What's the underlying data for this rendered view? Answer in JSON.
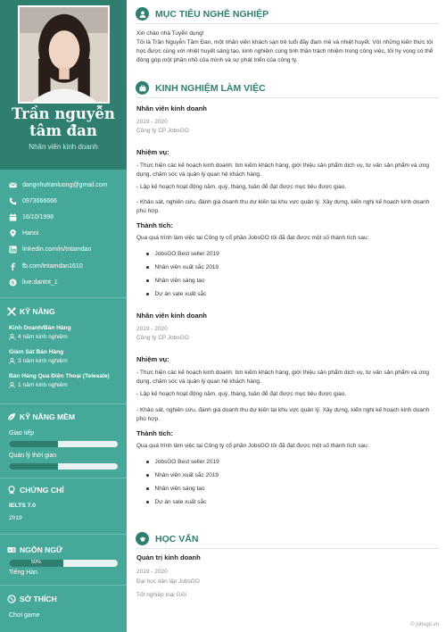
{
  "profile": {
    "name_line1": "Trần nguyễn",
    "name_line2": "tâm đan",
    "job_title": "Nhân viên kinh doanh"
  },
  "contacts": [
    {
      "icon": "email-icon",
      "text": "dangnhutranluong@gmail.com"
    },
    {
      "icon": "phone-icon",
      "text": "0973666666"
    },
    {
      "icon": "calendar-icon",
      "text": "16/10/1998"
    },
    {
      "icon": "location-icon",
      "text": "Hanoi"
    },
    {
      "icon": "linkedin-icon",
      "text": "linkedin.com/in/tntamdan"
    },
    {
      "icon": "facebook-icon",
      "text": "fb.com/tntamdan1610"
    },
    {
      "icon": "skype-icon",
      "text": "live:dantnt_1"
    }
  ],
  "skills": {
    "title": "KỸ NĂNG",
    "items": [
      {
        "name": "Kinh Doanh/Bán Hàng",
        "exp": "4 năm kinh nghiệm"
      },
      {
        "name": "Giám Sát Bán Hàng",
        "exp": "3 năm kinh nghiệm"
      },
      {
        "name": "Bán Hàng Qua Điện Thoại (Telesale)",
        "exp": "1 năm kinh nghiệm"
      }
    ]
  },
  "soft_skills": {
    "title": "KỸ NĂNG MỀM",
    "items": [
      {
        "name": "Giao tiếp",
        "level": 0.45
      },
      {
        "name": "Quản lý thời gian",
        "level": 0.45
      }
    ]
  },
  "certificates": {
    "title": "CHỨNG CHỈ",
    "name": "IELTS 7.0",
    "year": "2019"
  },
  "languages": {
    "title": "NGÔN NGỮ",
    "level_text": "50%",
    "level": 0.5,
    "name": "Tiếng Hàn"
  },
  "hobbies": {
    "title": "SỞ THÍCH",
    "item": "Chơi game"
  },
  "objective": {
    "title": "MỤC TIÊU NGHỀ NGHIỆP",
    "greeting": "Xin chào nhà Tuyển dụng!",
    "body": "Tôi là Trần Nguyễn Tâm Đan, một nhân viên khách sạn trẻ tuổi đầy đam mê và nhiệt huyết. Với những kiến thức tôi học được cùng với nhiệt huyết sáng tạo, kinh nghiệm cùng tinh thần trách nhiệm trong công việc, tôi hy vọng có thể đóng góp một phần nhỏ của mình và sự phát triển của công ty."
  },
  "experience": {
    "title": "KINH NGHIỆM LÀM VIỆC",
    "jobs": [
      {
        "position": "Nhân viên kinh doanh",
        "period": "2019 - 2020",
        "company": "Công ty CP JobsGO",
        "duties_label": "Nhiệm vụ:",
        "duty1": "- Thực hiện các kế hoạch kinh doanh: tìm kiếm khách hàng, giới thiệu sản phẩm dịch vụ, tư vấn sản phẩm và ứng dụng, chăm sóc và quản lý quan hệ khách hàng.",
        "duty2": "- Lập kế hoạch hoạt động năm, quý, tháng, tuần để đạt được mục tiêu được giao.",
        "duty3": "- Khảo sát, nghiên cứu, đánh giá doanh thu dự kiến tại khu vực quản lý. Xây dựng, kiến nghị kế hoạch kinh doanh phù hợp.",
        "achievements_label": "Thành tích:",
        "achievements_intro": "Qua quá trình làm việc tại Công ty cổ phần JobsGO tôi đã đạt được một số thành tích sau:",
        "achievements": [
          "JobsGO Best seller 2019",
          "Nhân viên xuất sắc 2019",
          "Nhân viên sáng tạo",
          "Dự án sale xuất sắc"
        ]
      },
      {
        "position": "Nhân viên kinh doanh",
        "period": "2019 - 2020",
        "company": "Công ty CP JobsGO",
        "duties_label": "Nhiệm vụ:",
        "duty1": "- Thực hiện các kế hoạch kinh doanh: tìm kiếm khách hàng, giới thiệu sản phẩm dịch vụ, tư vấn sản phẩm và ứng dụng, chăm sóc và quản lý quan hệ khách hàng.",
        "duty2": "- Lập kế hoạch hoạt động năm, quý, tháng, tuần để đạt được mục tiêu được giao.",
        "duty3": "- Khảo sát, nghiên cứu, đánh giá doanh thu dự kiến tại khu vực quản lý. Xây dựng, kiến nghị kế hoạch kinh doanh phù hợp.",
        "achievements_label": "Thành tích:",
        "achievements_intro": "Qua quá trình làm việc tại Công ty cổ phần JobsGO tôi đã đạt được một số thành tích sau:",
        "achievements": [
          "JobsGO Best seller 2019",
          "Nhân viên xuất sắc 2019",
          "Nhân viên sáng tạo",
          "Dự án sale xuất sắc"
        ]
      }
    ]
  },
  "education": {
    "title": "HỌC VẤN",
    "major": "Quản trị kinh doanh",
    "period": "2019 - 2020",
    "school": "Đại học dân lập JobsGO",
    "grade": "Tốt nghiệp loại Giỏi"
  },
  "footer": "© jobsgo.vn",
  "colors": {
    "sidebar": "#46a898",
    "sidebar_dark": "#2f7f71",
    "accent": "#2f7f71"
  }
}
